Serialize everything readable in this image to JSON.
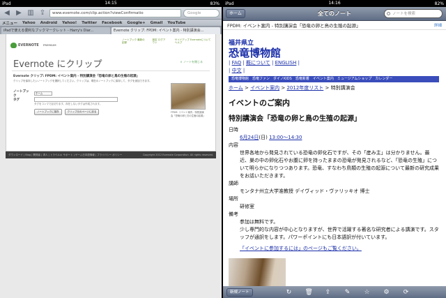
{
  "left": {
    "status": {
      "carrier": "iPad",
      "time": "14:15",
      "battery": "83%"
    },
    "url": "www.evernote.com/clip.action?viewConfirmatio",
    "search_placeholder": "Google",
    "bookmarks": [
      "メニュー",
      "Yahoo",
      "Android",
      "Yahoo!",
      "Twitter",
      "Facebook",
      "Google+",
      "Gmail",
      "YouTube"
    ],
    "tabs": [
      "iPadで使える便利なブックマークレット - Harry's Diar...",
      "Evernote クリップ: FPDM: イベント案内 - 特別講演会..."
    ],
    "evernote": {
      "logo": "EVERNOTE",
      "premium": "PREMIUM",
      "nav_links": [
        "ノートブック 最新の記録",
        "設定 ログアウト",
        "サイドアップ Evernoteについて ヘルプ"
      ],
      "title": "Evernote にクリップ",
      "close_link": "× ノートを閉じる",
      "clip_title": "Evernote クリップ: FPDM: イベント案内 - 特別講演会「恐竜の卵と鳥の生殖の起源」",
      "clip_note": "クリップを保存したいノートブックを選択してください。クリップは、現在のノートブックに保存して、タグを追加できます。",
      "notebook_label": "ノートブック",
      "notebook_value": "ホーム",
      "tag_label": "タグ",
      "tag_hint": "タグをコンマで区切ります。存在しないタグは作成されます。",
      "save_button": "ノートブックに保存",
      "back_button": "クリップ元のページに戻る",
      "thumb_caption": "FPDM: イベント案内 - 特別講演会「恐竜の卵と鳥の生殖の起源」",
      "footer_links": "ダウンロード | Blog | 開発者 | 求人 | トラベルキ サポート | ゲーム日本語情報 | プライバシー ポリシー",
      "footer_copy": "Copyright 2012 Evernote Corporation. All rights reserved."
    }
  },
  "right": {
    "status": {
      "carrier": "iPad",
      "time": "14:16",
      "battery": "82%"
    },
    "back_button": "ホーム",
    "title": "全てのノート",
    "search_placeholder": "ノートを検索",
    "note_title": "FPDM: イベント案内 - 特別講演会「恐竜の卵と鳥の生殖の起源」",
    "detail_link": "詳細",
    "content": {
      "prefecture": "福井県立",
      "museum": "恐竜博物館",
      "link_row1": [
        "FAQ",
        "概について",
        "ENGLISH"
      ],
      "link_row2": [
        "中文"
      ],
      "menu_bar": [
        "恐竜博物館",
        "恐竜ファン",
        "ダイノKIDS",
        "恐竜新着",
        "イベント案内",
        "ミュージアムショップ",
        "カレンダー"
      ],
      "breadcrumb": [
        "ホーム",
        "イベント案内",
        "2012年度リスト"
      ],
      "breadcrumb_current": "特別講演会",
      "h1": "イベントのご案内",
      "h2": "特別講演会「恐竜の卵と鳥の生殖の起源」",
      "date_label": "日時",
      "date": "6月24日",
      "date_weekday": "(日)",
      "time": "13:00～14:30",
      "content_label": "内容",
      "content_text": "世界各地から発見されている恐竜の卵化石ですが、その「産み主」は分かりません。最近、巣の中の卵化石やお腹に卵を持ったままの恐竜が発見されるなど、「恐竜の生殖」について明らかになりつつあります。恐竜、すなわち鳥類の生殖の起源について最新の研究成果をお話いただきます。",
      "speaker_label": "講師",
      "speaker": "モンタナ州立大学准教授 デイヴィッド・ヴァリッキオ 博士",
      "place_label": "場所",
      "place": "研修室",
      "remarks_label": "備考",
      "remarks_1": "参加は無料です。",
      "remarks_2": "少し専門的な内容が中心となりますが、世界で活躍する著名な研究者による講演です。スタッフが通訳をします。パワーポイントにも日本語訳が付いています。",
      "event_link": "「イベントに参加するには」のページもご覧ください。"
    },
    "new_note_button": "新規ノート",
    "toolbar_icons": [
      "rotate-icon",
      "trash-icon",
      "share-icon",
      "edit-icon",
      "star-icon",
      "settings-icon",
      "sync-icon"
    ]
  }
}
